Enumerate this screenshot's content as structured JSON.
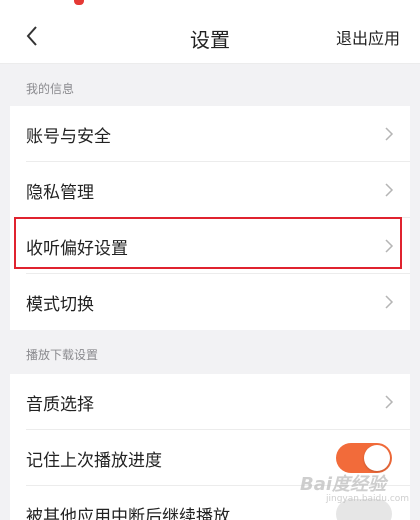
{
  "header": {
    "title": "设置",
    "exit_label": "退出应用"
  },
  "sections": [
    {
      "label": "我的信息",
      "items": [
        {
          "label": "账号与安全"
        },
        {
          "label": "隐私管理"
        },
        {
          "label": "收听偏好设置"
        },
        {
          "label": "模式切换"
        }
      ]
    },
    {
      "label": "播放下载设置",
      "items": [
        {
          "label": "音质选择"
        },
        {
          "label": "记住上次播放进度",
          "toggle_on": true
        },
        {
          "label": "被其他应用中断后继续播放"
        }
      ]
    }
  ],
  "colors": {
    "toggle_on": "#f26b3a",
    "highlight_box": "#e0232f"
  },
  "watermark": {
    "text": "Bai度经验",
    "sub": "jingyan.baidu.com"
  }
}
